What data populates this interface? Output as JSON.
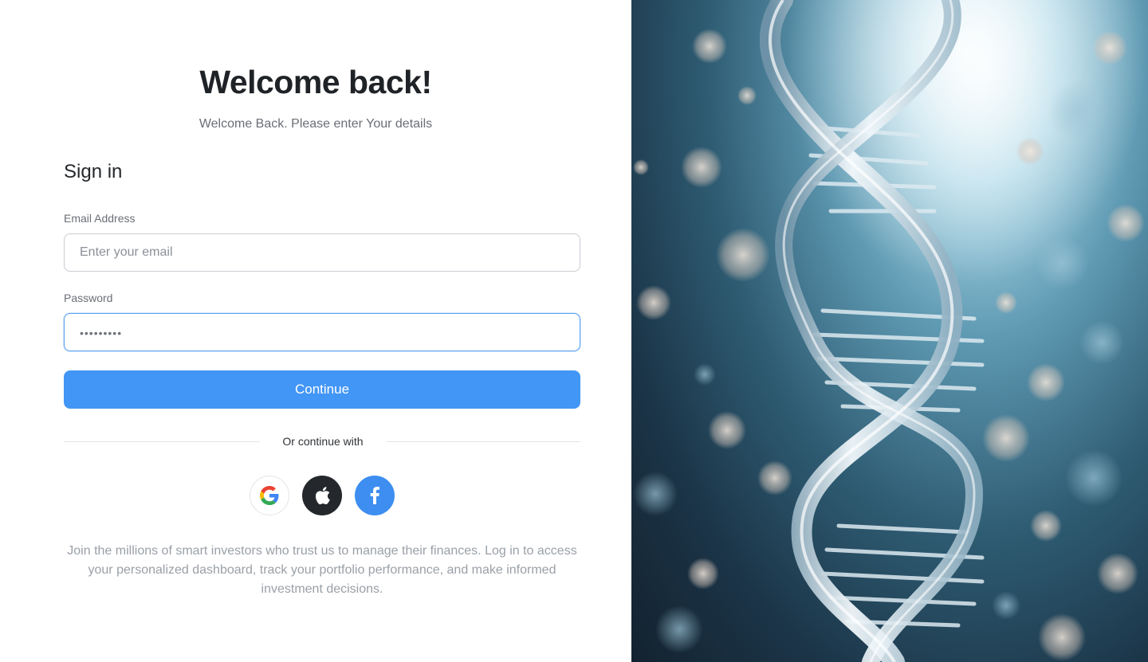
{
  "header": {
    "title": "Welcome back!",
    "subtitle": "Welcome Back. Please enter Your details"
  },
  "form": {
    "heading": "Sign in",
    "email": {
      "label": "Email Address",
      "placeholder": "Enter your email",
      "value": ""
    },
    "password": {
      "label": "Password",
      "masked_value": "•••••••••"
    },
    "continue_label": "Continue"
  },
  "divider": {
    "text": "Or continue with"
  },
  "social": [
    {
      "name": "google",
      "icon": "google-icon"
    },
    {
      "name": "apple",
      "icon": "apple-icon"
    },
    {
      "name": "facebook",
      "icon": "facebook-icon"
    }
  ],
  "footer": {
    "text": "Join the millions of smart investors who trust us to manage their finances. Log in to access your personalized dashboard, track your portfolio performance, and make informed investment decisions."
  },
  "hero": {
    "subject": "dna-helix-image"
  },
  "colors": {
    "primary": "#4296f5",
    "apple": "#24272b",
    "facebook": "#3d8ef0",
    "focus_border": "#5aa3f0"
  }
}
